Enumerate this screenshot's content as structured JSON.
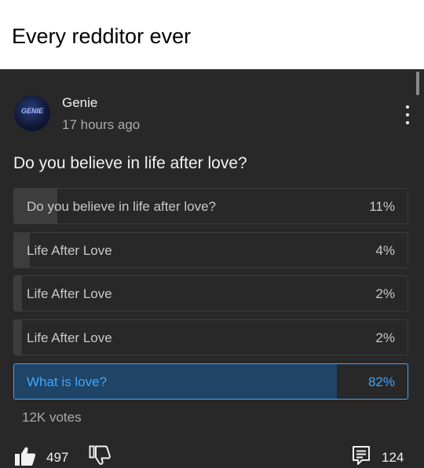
{
  "caption": "Every redditor ever",
  "post": {
    "avatar_text": "GENIE",
    "author": "Genie",
    "time": "17 hours ago",
    "question": "Do you believe in life after love?",
    "votes": "12K votes",
    "likes": "497",
    "comments": "124"
  },
  "poll": {
    "options": [
      {
        "label": "Do you believe in life after love?",
        "percent_label": "11%",
        "percent": 11,
        "selected": false
      },
      {
        "label": "Life After Love",
        "percent_label": "4%",
        "percent": 4,
        "selected": false
      },
      {
        "label": "Life After Love",
        "percent_label": "2%",
        "percent": 2,
        "selected": false
      },
      {
        "label": "Life After Love",
        "percent_label": "2%",
        "percent": 2,
        "selected": false
      },
      {
        "label": "What is love?",
        "percent_label": "82%",
        "percent": 82,
        "selected": true
      }
    ]
  },
  "icons": {
    "avatar": "genie-avatar",
    "menu": "more-vert-icon",
    "like": "thumbs-up-icon",
    "dislike": "thumbs-down-icon",
    "comments": "comment-icon"
  },
  "colors": {
    "background": "#282828",
    "accent": "#3ea6ff",
    "text": "#f1f1f1",
    "muted": "#aaaaaa"
  }
}
